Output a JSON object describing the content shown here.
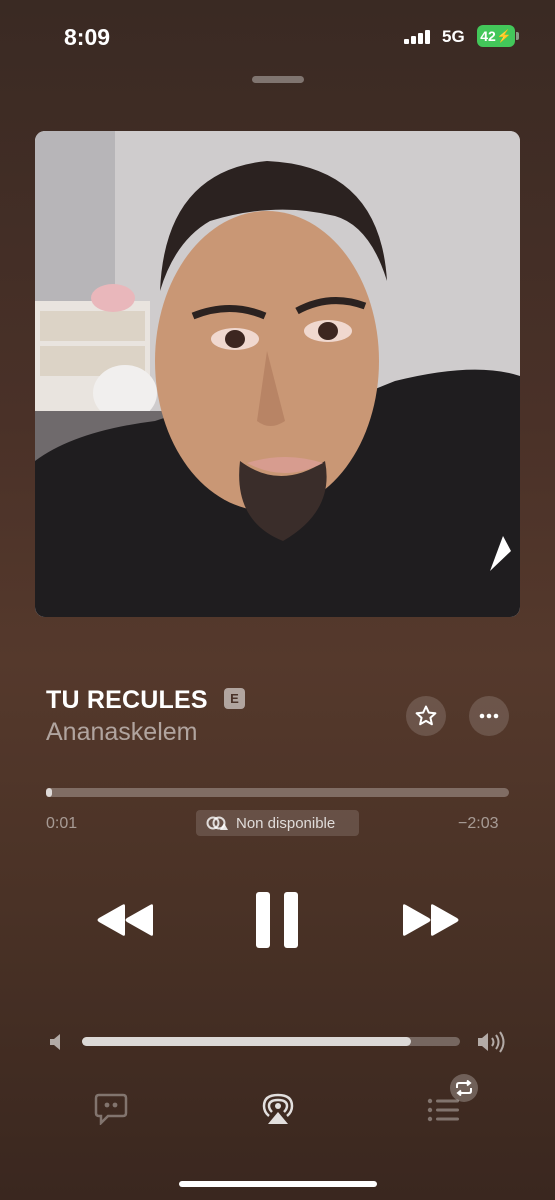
{
  "status_bar": {
    "time": "8:09",
    "network": "5G",
    "battery": "42"
  },
  "track": {
    "title": "TU RECULES",
    "explicit_badge": "E",
    "artist": "Ananaskelem",
    "artwork_icon": "album-artwork-portrait"
  },
  "playback": {
    "elapsed": "0:01",
    "remaining": "−2:03",
    "progress_fraction": 0.008,
    "availability_label": "Non disponible",
    "state": "playing"
  },
  "volume": {
    "level_fraction": 0.87
  },
  "icons": {
    "favorite": "star-icon",
    "more": "more-icon",
    "rewind": "rewind-icon",
    "pause": "pause-icon",
    "forward": "fast-forward-icon",
    "lyrics": "lyrics-icon",
    "airplay": "airplay-icon",
    "queue": "queue-icon",
    "repeat": "repeat-icon"
  },
  "colors": {
    "background": "#4a3128",
    "battery": "#43c75a",
    "text_primary": "#ffffff"
  }
}
